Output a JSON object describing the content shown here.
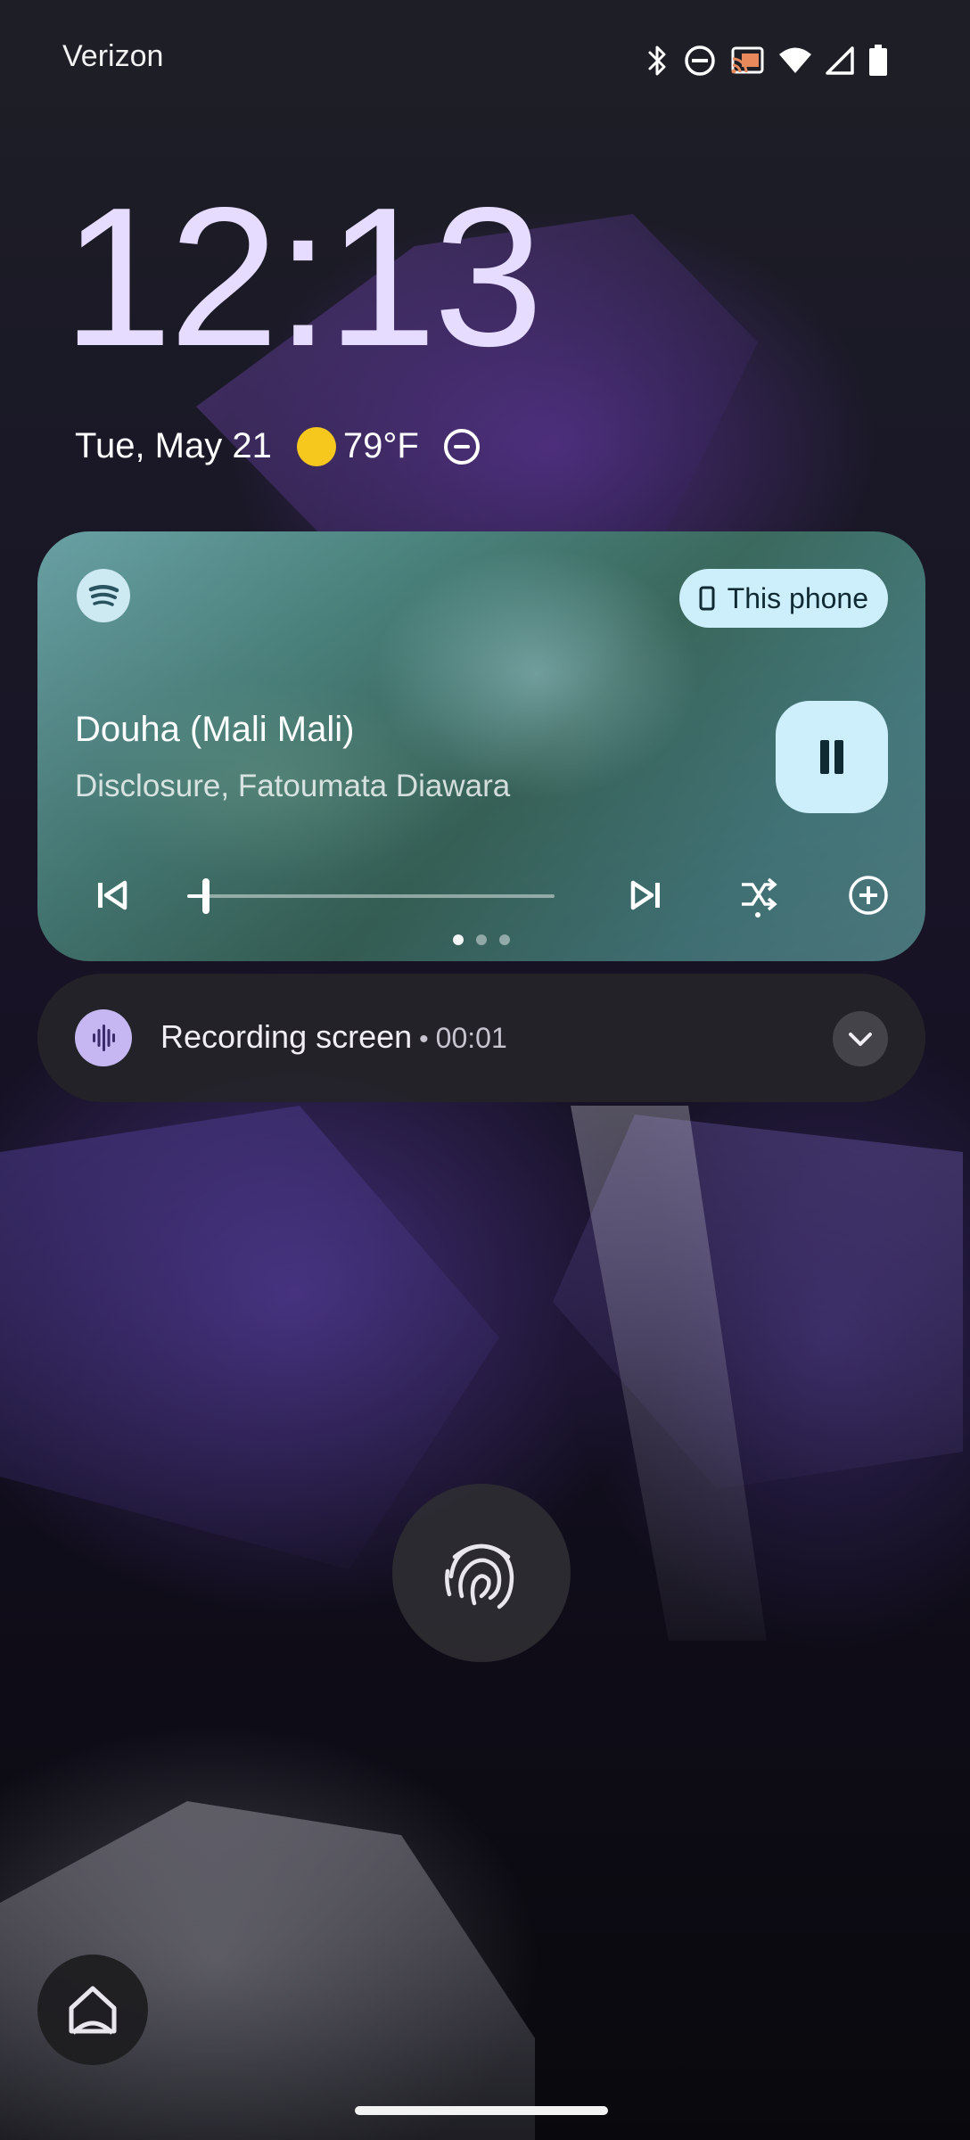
{
  "status_bar": {
    "carrier": "Verizon",
    "icons": [
      "bluetooth-icon",
      "do-not-disturb-icon",
      "cast-icon",
      "wifi-icon",
      "signal-icon",
      "battery-icon"
    ]
  },
  "lockscreen": {
    "time": "12:13",
    "date": "Tue, May 21",
    "weather_icon": "sun-icon",
    "temperature": "79°F",
    "dnd_icon": "do-not-disturb-icon"
  },
  "media_player": {
    "app_icon": "spotify-icon",
    "output_device": "This phone",
    "track_title": "Douha (Mali Mali)",
    "artist": "Disclosure, Fatoumata Diawara",
    "progress": 0.05,
    "page_count": 3,
    "active_page": 1,
    "controls": [
      "previous-icon",
      "next-icon",
      "shuffle-icon",
      "add-icon"
    ],
    "play_state": "playing"
  },
  "recording_notification": {
    "title": "Recording screen",
    "separator": "•",
    "elapsed": "00:01"
  },
  "colors": {
    "clock": "#e6dcff",
    "media_accent": "#cdeefb",
    "recording_icon": "#c6b6f2",
    "weather_sun": "#f6c81e"
  }
}
